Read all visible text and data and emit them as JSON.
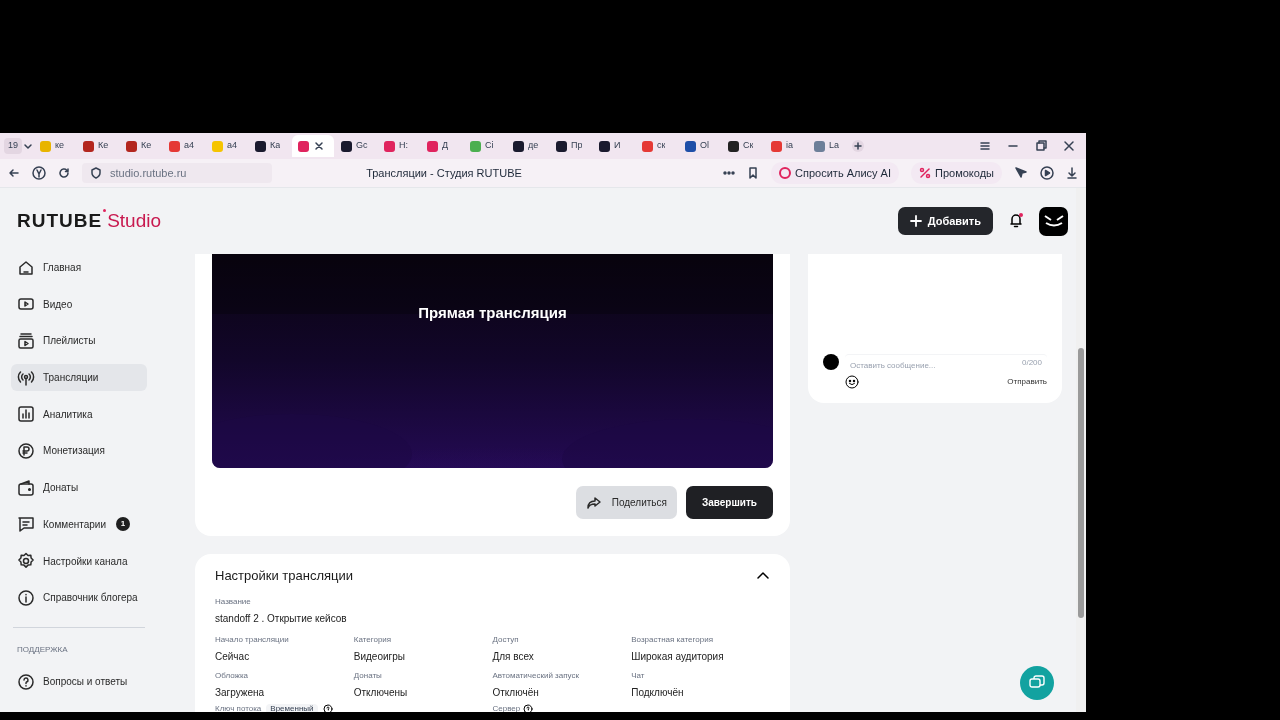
{
  "browser": {
    "tab_counter": "19",
    "tabs": [
      {
        "label": "ке",
        "selected": false,
        "color": "#e8b400"
      },
      {
        "label": "Ке",
        "selected": false,
        "color": "#b3261e"
      },
      {
        "label": "Ке",
        "selected": false,
        "color": "#b3261e"
      },
      {
        "label": "а4",
        "selected": false,
        "color": "#e53935"
      },
      {
        "label": "а4",
        "selected": false,
        "color": "#f5c400"
      },
      {
        "label": "Ка",
        "selected": false,
        "color": "#1a1a2e"
      },
      {
        "selected": true,
        "color": "#e0245e"
      },
      {
        "label": "Gc",
        "selected": false,
        "color": "#1a1a2e"
      },
      {
        "label": "Н:",
        "selected": false,
        "color": "#e0245e"
      },
      {
        "label": "Д",
        "selected": false,
        "color": "#e0245e"
      },
      {
        "label": "Сі",
        "selected": false,
        "color": "#4caf50"
      },
      {
        "label": "де",
        "selected": false,
        "color": "#1a1a2e"
      },
      {
        "label": "Пр",
        "selected": false,
        "color": "#1a1a2e"
      },
      {
        "label": "И",
        "selected": false,
        "color": "#1a1a2e"
      },
      {
        "label": "ск",
        "selected": false,
        "color": "#e53935"
      },
      {
        "label": "Ol",
        "selected": false,
        "color": "#1e4fa8"
      },
      {
        "label": "Ск",
        "selected": false,
        "color": "#222222"
      },
      {
        "label": "ia",
        "selected": false,
        "color": "#e53935"
      },
      {
        "label": "La",
        "selected": false,
        "color": "#6d7f99"
      }
    ],
    "address": "studio.rutube.ru",
    "page_title": "Трансляции - Студия RUTUBE",
    "ask_alice": "Спросить Алису AI",
    "promo": "Промокоды"
  },
  "header": {
    "logo": "RUTUBE",
    "logo_suffix": "Studio",
    "add_button": "Добавить",
    "notification_dot": true
  },
  "sidebar": {
    "items": [
      {
        "label": "Главная",
        "selected": false
      },
      {
        "label": "Видео",
        "selected": false
      },
      {
        "label": "Плейлисты",
        "selected": false
      },
      {
        "label": "Трансляции",
        "selected": true
      },
      {
        "label": "Аналитика",
        "selected": false
      },
      {
        "label": "Монетизация",
        "selected": false
      },
      {
        "label": "Донаты",
        "selected": false
      },
      {
        "label": "Комментарии",
        "selected": false,
        "badge": "1"
      },
      {
        "label": "Настройки канала",
        "selected": false
      },
      {
        "label": "Справочник блогера",
        "selected": false
      }
    ],
    "support_heading": "ПОДДЕРЖКА",
    "support_items": [
      {
        "label": "Вопросы и ответы",
        "selected": false
      }
    ]
  },
  "player": {
    "title": "Прямая трансляция",
    "share_button": "Поделиться",
    "finish_button": "Завершить"
  },
  "chat": {
    "placeholder": "Оставить сообщение...",
    "counter": "0/200",
    "send": "Отправить"
  },
  "settings": {
    "title": "Настройки трансляции",
    "expanded": true,
    "name_label": "Название",
    "name_value": "standoff 2 . Открытие кейсов",
    "fields": [
      {
        "label": "Начало трансляции",
        "value": "Сейчас"
      },
      {
        "label": "Категория",
        "value": "Видеоигры"
      },
      {
        "label": "Доступ",
        "value": "Для всех"
      },
      {
        "label": "Возрастная категория",
        "value": "Широкая аудитория"
      },
      {
        "label": "Обложка",
        "value": "Загружена"
      },
      {
        "label": "Донаты",
        "value": "Отключены"
      },
      {
        "label": "Автоматический запуск",
        "value": "Отключён"
      },
      {
        "label": "Чат",
        "value": "Подключён"
      }
    ],
    "stream_key_label": "Ключ потока",
    "stream_key_tag": "Временный",
    "server_label": "Сервер"
  }
}
